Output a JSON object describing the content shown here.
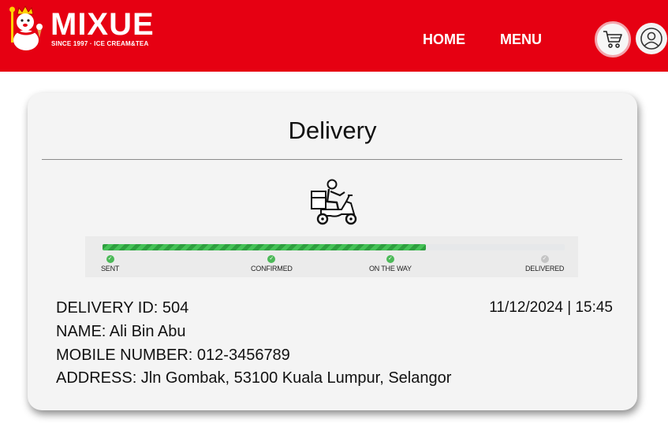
{
  "header": {
    "brand_name": "MIXUE",
    "brand_tagline": "SINCE 1997 · ICE CREAM&TEA",
    "nav": [
      {
        "label": "HOME"
      },
      {
        "label": "MENU"
      }
    ],
    "cart_icon": "shopping-cart-icon",
    "profile_icon": "user-profile-icon"
  },
  "colors": {
    "brand_red": "#e60012",
    "progress_green": "#3bb44a",
    "step_done": "#4cb958",
    "step_pending": "#c4c4c4"
  },
  "delivery": {
    "title": "Delivery",
    "rider_icon": "delivery-scooter-icon",
    "progress": {
      "fraction_complete": 0.7,
      "steps": [
        {
          "label": "SENT",
          "status": "done"
        },
        {
          "label": "CONFIRMED",
          "status": "done"
        },
        {
          "label": "ON THE WAY",
          "status": "done"
        },
        {
          "label": "DELIVERED",
          "status": "pending"
        }
      ]
    },
    "details": {
      "delivery_id": "DELIVERY ID: 504",
      "name": "NAME: Ali Bin Abu",
      "mobile": "MOBILE NUMBER: 012-3456789",
      "address": "ADDRESS: Jln Gombak, 53100 Kuala Lumpur, Selangor",
      "datetime": "11/12/2024 | 15:45"
    }
  }
}
